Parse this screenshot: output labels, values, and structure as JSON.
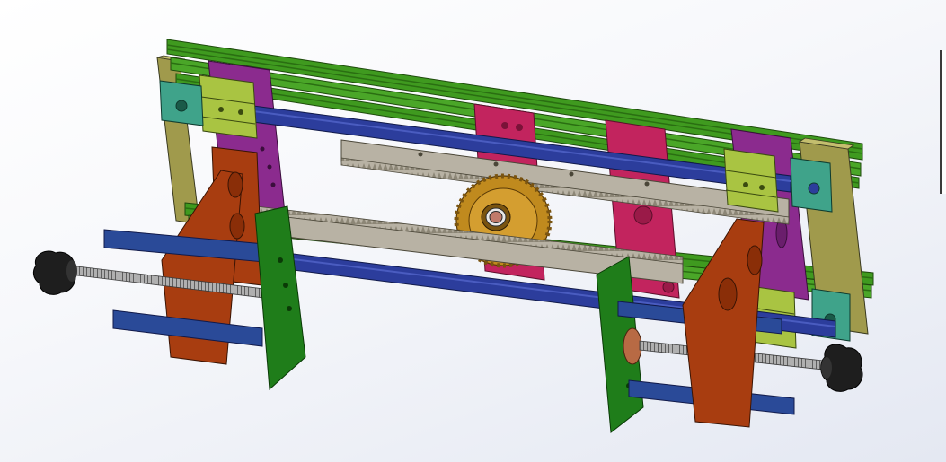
{
  "viewport": {
    "background_top": "#ffffff",
    "background_bottom": "#e4e8f2"
  },
  "model": {
    "colors": {
      "extrusion_green": "#3f9a1f",
      "extrusion_dark": "#2a6e12",
      "frame_olive": "#a09a4c",
      "magenta_plate": "#8b2b8e",
      "crimson_block": "#c2245e",
      "rack_gray": "#b8b2a4",
      "gear_gold": "#c08a1e",
      "rod_blue": "#2c3d9c",
      "rod_navy": "#2a4a98",
      "bracket_orange": "#a83d10",
      "plate_green": "#1f7d1a",
      "bearing_lime": "#a9c442",
      "support_teal": "#3fa38a",
      "screw_gray": "#9a9a9a",
      "knob_black": "#1e1e1e",
      "nut_copper": "#b86a44"
    },
    "components": [
      "aluminum-extrusion-rail",
      "side-frame-plate",
      "linear-bearing-block",
      "shaft-support",
      "guide-rod",
      "gear-rack",
      "spur-gear",
      "lead-screw",
      "clamp-knob",
      "clamp-bracket",
      "clamp-jaw-plate"
    ]
  }
}
